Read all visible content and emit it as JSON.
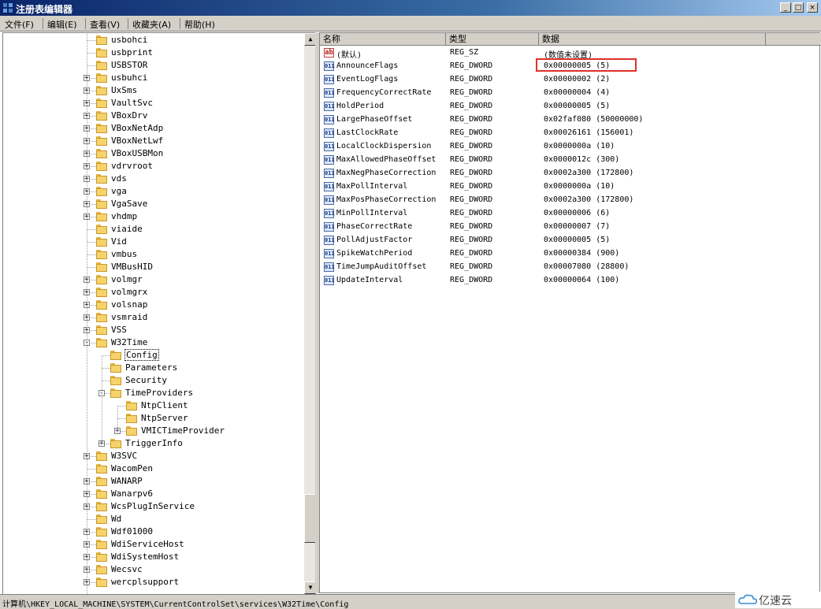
{
  "window": {
    "title": "注册表编辑器",
    "controls": [
      "_",
      "□",
      "×"
    ]
  },
  "menu": [
    {
      "label": "文件(F)"
    },
    {
      "label": "编辑(E)"
    },
    {
      "label": "查看(V)"
    },
    {
      "label": "收藏夹(A)"
    },
    {
      "label": "帮助(H)"
    }
  ],
  "tree": [
    {
      "label": "usbohci",
      "level": 0,
      "expander": null
    },
    {
      "label": "usbprint",
      "level": 0,
      "expander": null
    },
    {
      "label": "USBSTOR",
      "level": 0,
      "expander": null
    },
    {
      "label": "usbuhci",
      "level": 0,
      "expander": "+"
    },
    {
      "label": "UxSms",
      "level": 0,
      "expander": "+"
    },
    {
      "label": "VaultSvc",
      "level": 0,
      "expander": "+"
    },
    {
      "label": "VBoxDrv",
      "level": 0,
      "expander": "+"
    },
    {
      "label": "VBoxNetAdp",
      "level": 0,
      "expander": "+"
    },
    {
      "label": "VBoxNetLwf",
      "level": 0,
      "expander": "+"
    },
    {
      "label": "VBoxUSBMon",
      "level": 0,
      "expander": "+"
    },
    {
      "label": "vdrvroot",
      "level": 0,
      "expander": "+"
    },
    {
      "label": "vds",
      "level": 0,
      "expander": "+"
    },
    {
      "label": "vga",
      "level": 0,
      "expander": "+"
    },
    {
      "label": "VgaSave",
      "level": 0,
      "expander": "+"
    },
    {
      "label": "vhdmp",
      "level": 0,
      "expander": "+"
    },
    {
      "label": "viaide",
      "level": 0,
      "expander": null
    },
    {
      "label": "Vid",
      "level": 0,
      "expander": null
    },
    {
      "label": "vmbus",
      "level": 0,
      "expander": null
    },
    {
      "label": "VMBusHID",
      "level": 0,
      "expander": null
    },
    {
      "label": "volmgr",
      "level": 0,
      "expander": "+"
    },
    {
      "label": "volmgrx",
      "level": 0,
      "expander": "+"
    },
    {
      "label": "volsnap",
      "level": 0,
      "expander": "+"
    },
    {
      "label": "vsmraid",
      "level": 0,
      "expander": "+"
    },
    {
      "label": "VSS",
      "level": 0,
      "expander": "+"
    },
    {
      "label": "W32Time",
      "level": 0,
      "expander": "-"
    },
    {
      "label": "Config",
      "level": 1,
      "expander": null,
      "selected": true
    },
    {
      "label": "Parameters",
      "level": 1,
      "expander": null
    },
    {
      "label": "Security",
      "level": 1,
      "expander": null
    },
    {
      "label": "TimeProviders",
      "level": 1,
      "expander": "-"
    },
    {
      "label": "NtpClient",
      "level": 2,
      "expander": null
    },
    {
      "label": "NtpServer",
      "level": 2,
      "expander": null
    },
    {
      "label": "VMICTimeProvider",
      "level": 2,
      "expander": "+"
    },
    {
      "label": "TriggerInfo",
      "level": 1,
      "expander": "+"
    },
    {
      "label": "W3SVC",
      "level": 0,
      "expander": "+"
    },
    {
      "label": "WacomPen",
      "level": 0,
      "expander": null
    },
    {
      "label": "WANARP",
      "level": 0,
      "expander": "+"
    },
    {
      "label": "Wanarpv6",
      "level": 0,
      "expander": "+"
    },
    {
      "label": "WcsPlugInService",
      "level": 0,
      "expander": "+"
    },
    {
      "label": "Wd",
      "level": 0,
      "expander": null
    },
    {
      "label": "Wdf01000",
      "level": 0,
      "expander": "+"
    },
    {
      "label": "WdiServiceHost",
      "level": 0,
      "expander": "+"
    },
    {
      "label": "WdiSystemHost",
      "level": 0,
      "expander": "+"
    },
    {
      "label": "Wecsvc",
      "level": 0,
      "expander": "+"
    },
    {
      "label": "wercplsupport",
      "level": 0,
      "expander": "+"
    }
  ],
  "columns": {
    "name": "名称",
    "type": "类型",
    "data": "数据"
  },
  "values": [
    {
      "icon": "ab",
      "name": "(默认)",
      "type": "REG_SZ",
      "data": "(数值未设置)"
    },
    {
      "icon": "dword",
      "name": "AnnounceFlags",
      "type": "REG_DWORD",
      "data": "0x00000005 (5)",
      "highlighted": true
    },
    {
      "icon": "dword",
      "name": "EventLogFlags",
      "type": "REG_DWORD",
      "data": "0x00000002 (2)"
    },
    {
      "icon": "dword",
      "name": "FrequencyCorrectRate",
      "type": "REG_DWORD",
      "data": "0x00000004 (4)"
    },
    {
      "icon": "dword",
      "name": "HoldPeriod",
      "type": "REG_DWORD",
      "data": "0x00000005 (5)"
    },
    {
      "icon": "dword",
      "name": "LargePhaseOffset",
      "type": "REG_DWORD",
      "data": "0x02faf080 (50000000)"
    },
    {
      "icon": "dword",
      "name": "LastClockRate",
      "type": "REG_DWORD",
      "data": "0x00026161 (156001)"
    },
    {
      "icon": "dword",
      "name": "LocalClockDispersion",
      "type": "REG_DWORD",
      "data": "0x0000000a (10)"
    },
    {
      "icon": "dword",
      "name": "MaxAllowedPhaseOffset",
      "type": "REG_DWORD",
      "data": "0x0000012c (300)"
    },
    {
      "icon": "dword",
      "name": "MaxNegPhaseCorrection",
      "type": "REG_DWORD",
      "data": "0x0002a300 (172800)"
    },
    {
      "icon": "dword",
      "name": "MaxPollInterval",
      "type": "REG_DWORD",
      "data": "0x0000000a (10)"
    },
    {
      "icon": "dword",
      "name": "MaxPosPhaseCorrection",
      "type": "REG_DWORD",
      "data": "0x0002a300 (172800)"
    },
    {
      "icon": "dword",
      "name": "MinPollInterval",
      "type": "REG_DWORD",
      "data": "0x00000006 (6)"
    },
    {
      "icon": "dword",
      "name": "PhaseCorrectRate",
      "type": "REG_DWORD",
      "data": "0x00000007 (7)"
    },
    {
      "icon": "dword",
      "name": "PollAdjustFactor",
      "type": "REG_DWORD",
      "data": "0x00000005 (5)"
    },
    {
      "icon": "dword",
      "name": "SpikeWatchPeriod",
      "type": "REG_DWORD",
      "data": "0x00000384 (900)"
    },
    {
      "icon": "dword",
      "name": "TimeJumpAuditOffset",
      "type": "REG_DWORD",
      "data": "0x00007080 (28800)"
    },
    {
      "icon": "dword",
      "name": "UpdateInterval",
      "type": "REG_DWORD",
      "data": "0x00000064 (100)"
    }
  ],
  "icon_text": {
    "ab": "ab",
    "dword": "011"
  },
  "status": {
    "path": "计算机\\HKEY_LOCAL_MACHINE\\SYSTEM\\CurrentControlSet\\services\\W32Time\\Config"
  },
  "watermark": {
    "text": "亿速云"
  },
  "colors": {
    "highlight_box": "#e0302a",
    "titlebar": "#0a246a"
  }
}
